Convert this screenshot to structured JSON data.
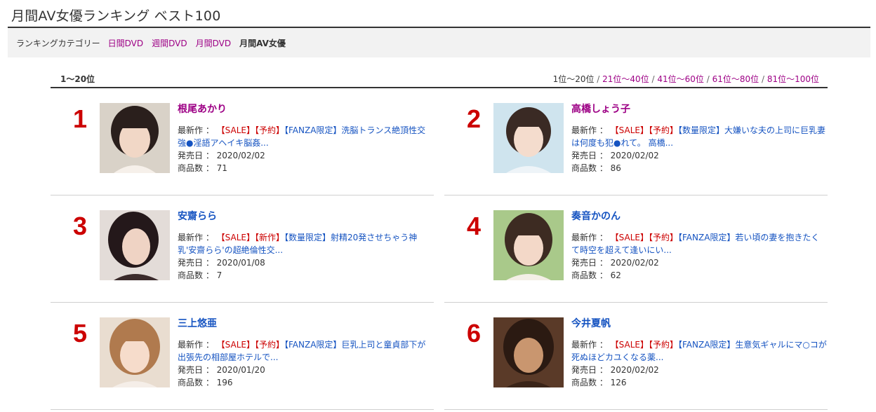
{
  "page": {
    "title": "月間AV女優ランキング ベスト100"
  },
  "categories": {
    "label": "ランキングカテゴリー",
    "links": [
      "日間DVD",
      "週間DVD",
      "月間DVD"
    ],
    "current": "月間AV女優"
  },
  "range": {
    "current": "1〜20位",
    "pager_current": "1位〜20位",
    "pager_links": [
      "21位〜40位",
      "41位〜60位",
      "61位〜80位",
      "81位〜100位"
    ],
    "separator": " / "
  },
  "labels": {
    "latest": "最新作 ：",
    "release": "発売日 ：",
    "count": "商品数 ："
  },
  "entries": [
    {
      "rank": "1",
      "name": "根尾あかり",
      "tags": [
        "【SALE】",
        "【予約】"
      ],
      "work": "【FANZA限定】洗脳トランス絶頂性交 強●淫語アヘイキ脳姦...",
      "release": "2020/02/02",
      "count": "71",
      "name_color": "#9d0085"
    },
    {
      "rank": "2",
      "name": "高橋しょう子",
      "tags": [
        "【SALE】",
        "【予約】"
      ],
      "work": "【数量限定】大嫌いな夫の上司に巨乳妻は何度も犯●れて。 高橋...",
      "release": "2020/02/02",
      "count": "86",
      "name_color": "#9d0085"
    },
    {
      "rank": "3",
      "name": "安齋らら",
      "tags": [
        "【SALE】",
        "【新作】"
      ],
      "work": "【数量限定】射精20発させちゃう神乳'安齋らら'の超絶倫性交...",
      "release": "2020/01/08",
      "count": "7",
      "name_color": "#1553c1"
    },
    {
      "rank": "4",
      "name": "奏音かのん",
      "tags": [
        "【SALE】",
        "【予約】"
      ],
      "work": "【FANZA限定】若い頃の妻を抱きたくて時空を超えて逢いにい...",
      "release": "2020/02/02",
      "count": "62",
      "name_color": "#1553c1"
    },
    {
      "rank": "5",
      "name": "三上悠亜",
      "tags": [
        "【SALE】",
        "【予約】"
      ],
      "work": "【FANZA限定】巨乳上司と童貞部下が出張先の相部屋ホテルで...",
      "release": "2020/01/20",
      "count": "196",
      "name_color": "#1553c1"
    },
    {
      "rank": "6",
      "name": "今井夏帆",
      "tags": [
        "【SALE】",
        "【予約】"
      ],
      "work": "【FANZA限定】生意気ギャルにマ○コが死ぬほどカユくなる薬...",
      "release": "2020/02/02",
      "count": "126",
      "name_color": "#1553c1"
    }
  ],
  "colors": {
    "rank": "#cc0000",
    "link_purple": "#9d0085",
    "link_blue": "#1553c1"
  }
}
